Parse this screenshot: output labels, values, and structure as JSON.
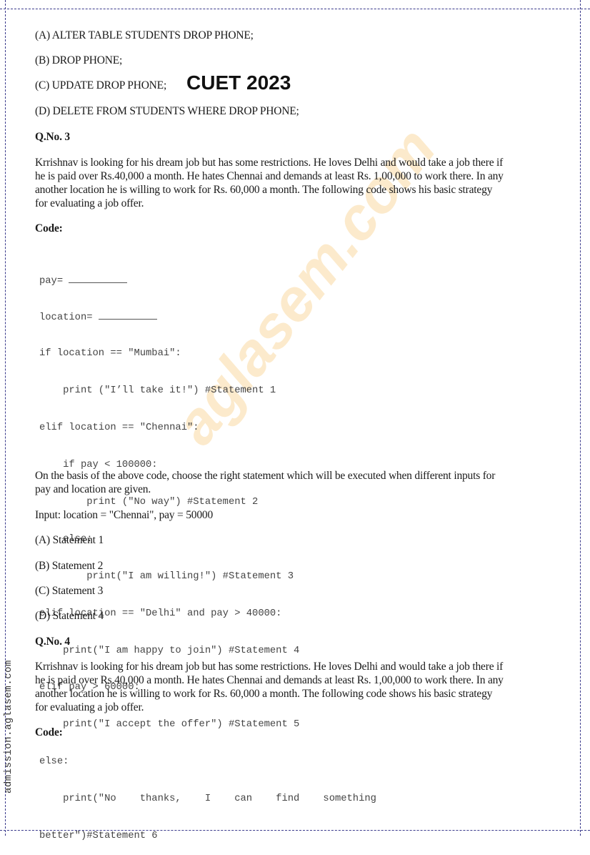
{
  "header_stamp": "CUET 2023",
  "side_watermark": "admission.aglasem.com",
  "center_watermark": "aglasem.com",
  "prev_question_options": [
    "(A) ALTER TABLE STUDENTS DROP PHONE;",
    "(B) DROP PHONE;",
    "(C) UPDATE DROP PHONE;",
    "(D) DELETE FROM STUDENTS WHERE DROP PHONE;"
  ],
  "q3": {
    "heading": "Q.No. 3",
    "intro_lines": [
      "Krrishnav is looking for his dream job but has some restrictions. He loves Delhi and would take a job there if",
      "he is paid over Rs.40,000 a month. He hates Chennai and demands at least Rs. 1,00,000 to work there. In any",
      "another location he is willing to work for Rs. 60,000 a month. The following code shows his basic strategy",
      "for evaluating a job offer."
    ],
    "code_label": "Code:",
    "code_lines": [
      "pay= ",
      "location= ",
      "if location == \"Mumbai\":",
      "    print (\"I’ll take it!\") #Statement 1",
      "elif location == \"Chennai\":",
      "    if pay < 100000:",
      "        print (\"No way\") #Statement 2",
      "    else:",
      "        print(\"I am willing!\") #Statement 3",
      "elif location == \"Delhi\" and pay > 40000:",
      "    print(\"I am happy to join\") #Statement 4",
      "elif pay > 60000:",
      "    print(\"I accept the offer\") #Statement 5",
      "else:",
      "    print(\"No    thanks,    I    can    find    something",
      "better\")#Statement 6"
    ],
    "question_lines": [
      "On the basis of the above code, choose the right statement which will be executed when different inputs for",
      "pay and location are given."
    ],
    "input": "Input: location = \"Chennai\", pay = 50000",
    "options": [
      "(A) Statement 1",
      "(B) Statement 2",
      "(C) Statement 3",
      "(D) Statement 4"
    ]
  },
  "q4": {
    "heading": "Q.No. 4",
    "intro_lines": [
      "Krrishnav is looking for his dream job but has some restrictions. He loves Delhi and would take a job there if",
      "he is paid over Rs.40,000 a month. He hates Chennai and demands at least Rs. 1,00,000 to work there. In any",
      "another location he is willing to work for Rs. 60,000 a month. The following code shows his basic strategy",
      "for evaluating a job offer."
    ],
    "code_label": "Code:"
  }
}
